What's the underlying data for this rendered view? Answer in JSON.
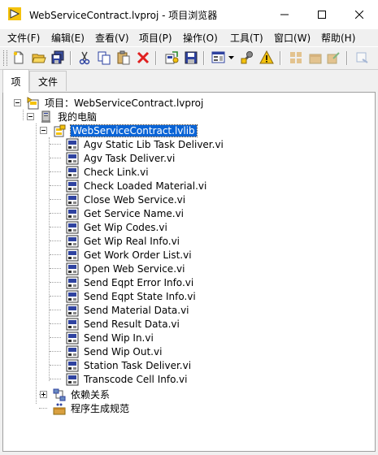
{
  "window": {
    "title": "WebServiceContract.lvproj - 项目浏览器",
    "controls": [
      "minimize-icon",
      "maximize-icon",
      "close-icon"
    ]
  },
  "menu": [
    {
      "label": "文件(F)"
    },
    {
      "label": "编辑(E)"
    },
    {
      "label": "查看(V)"
    },
    {
      "label": "项目(P)"
    },
    {
      "label": "操作(O)"
    },
    {
      "label": "工具(T)"
    },
    {
      "label": "窗口(W)"
    },
    {
      "label": "帮助(H)"
    }
  ],
  "toolbar": {
    "icons": [
      "new-icon",
      "open-icon",
      "save-all-icon",
      "cut-icon",
      "copy-icon",
      "paste-icon",
      "delete-icon",
      "build-icon",
      "save-icon",
      "view-options-icon",
      "dropdown-arrow-icon",
      "wrench-icon",
      "warning-icon",
      "group-icon",
      "package-icon",
      "edit-icon",
      "more-icon"
    ]
  },
  "tabs": [
    {
      "label": "项"
    },
    {
      "label": "文件"
    }
  ],
  "tree": {
    "project": "项目：WebServiceContract.lvproj",
    "computer": "我的电脑",
    "library": "WebServiceContract.lvlib",
    "vis": [
      "Agv Static Lib Task Deliver.vi",
      "Agv Task Deliver.vi",
      "Check Link.vi",
      "Check Loaded Material.vi",
      "Close Web Service.vi",
      "Get Service Name.vi",
      "Get Wip Codes.vi",
      "Get Wip Real Info.vi",
      "Get Work Order List.vi",
      "Open Web Service.vi",
      "Send Eqpt Error Info.vi",
      "Send Eqpt State Info.vi",
      "Send Material Data.vi",
      "Send Result Data.vi",
      "Send Wip In.vi",
      "Send Wip Out.vi",
      "Station Task Deliver.vi",
      "Transcode Cell Info.vi"
    ],
    "dependencies": "依赖关系",
    "build_specs": "程序生成规范"
  },
  "colors": {
    "selection": "#0a64d6",
    "labview_yellow": "#f4c20d"
  }
}
